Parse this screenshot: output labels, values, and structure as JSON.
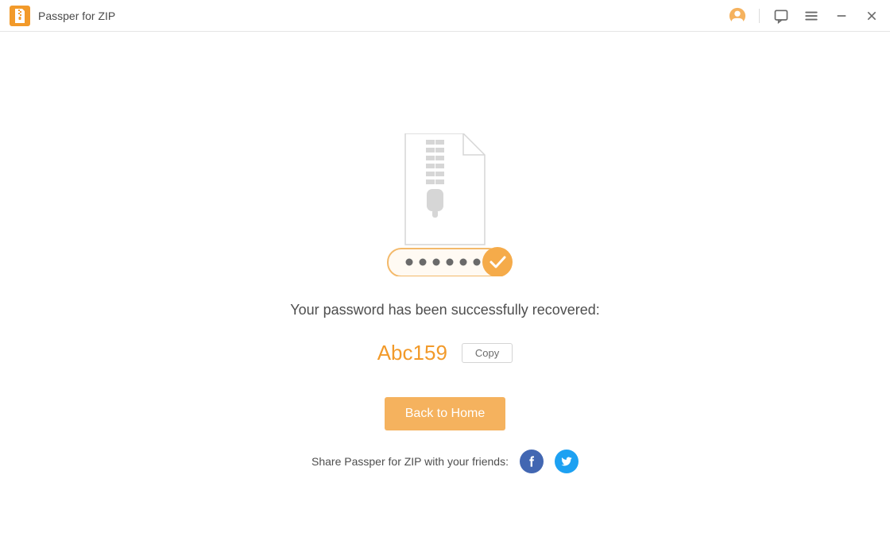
{
  "titlebar": {
    "app_title": "Passper for ZIP"
  },
  "main": {
    "success_message": "Your password has been successfully recovered:",
    "recovered_password": "Abc159",
    "copy_label": "Copy",
    "back_label": "Back to Home",
    "share_text": "Share Passper for ZIP with your friends:"
  },
  "icons": {
    "user": "user-icon",
    "feedback": "feedback-icon",
    "menu": "menu-icon",
    "minimize": "minimize-icon",
    "close": "close-icon",
    "checkmark": "checkmark-icon",
    "facebook": "facebook-icon",
    "twitter": "twitter-icon"
  },
  "colors": {
    "accent": "#f29a2a",
    "button_bg": "#f5b25e",
    "facebook": "#4267b2",
    "twitter": "#1da1f2"
  }
}
